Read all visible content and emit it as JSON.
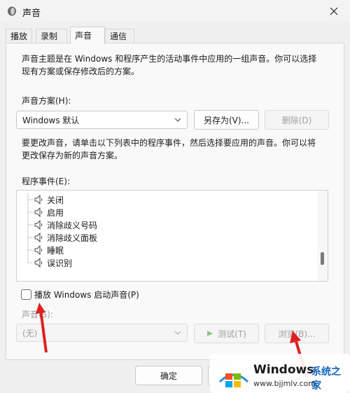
{
  "window": {
    "title": "声音"
  },
  "tabs": [
    {
      "label": "播放"
    },
    {
      "label": "录制"
    },
    {
      "label": "声音"
    },
    {
      "label": "通信"
    }
  ],
  "active_tab": "声音",
  "intro_line1": "声音主题是在 Windows 和程序产生的活动事件中应用的一组声音。你可以选择",
  "intro_line2": "现有方案或保存修改后的方案。",
  "scheme": {
    "label": "声音方案(H):",
    "value": "Windows 默认",
    "save_as": "另存为(V)...",
    "delete": "删除(D)"
  },
  "change_line1": "要更改声音，请单击以下列表中的程序事件，然后选择要应用的声音。你可以将",
  "change_line2": "更改保存为新的声音方案。",
  "events": {
    "label": "程序事件(E):",
    "items": [
      "关闭",
      "启用",
      "消除歧义号码",
      "消除歧义面板",
      "睡眠",
      "误识别"
    ]
  },
  "startup": {
    "label": "播放 Windows 启动声音(P)",
    "checked": false
  },
  "sound": {
    "label": "声音(S):",
    "value": "(无)",
    "test": "测试(T)",
    "browse": "浏览(B)..."
  },
  "footer": {
    "ok": "确定"
  },
  "watermark": {
    "title": "Windows",
    "subtitle": "系统之家",
    "url": "www.bjjmlv.com"
  },
  "colors": {
    "annotation_arrow": "#e02020",
    "window_bg": "#f0f0f0"
  }
}
